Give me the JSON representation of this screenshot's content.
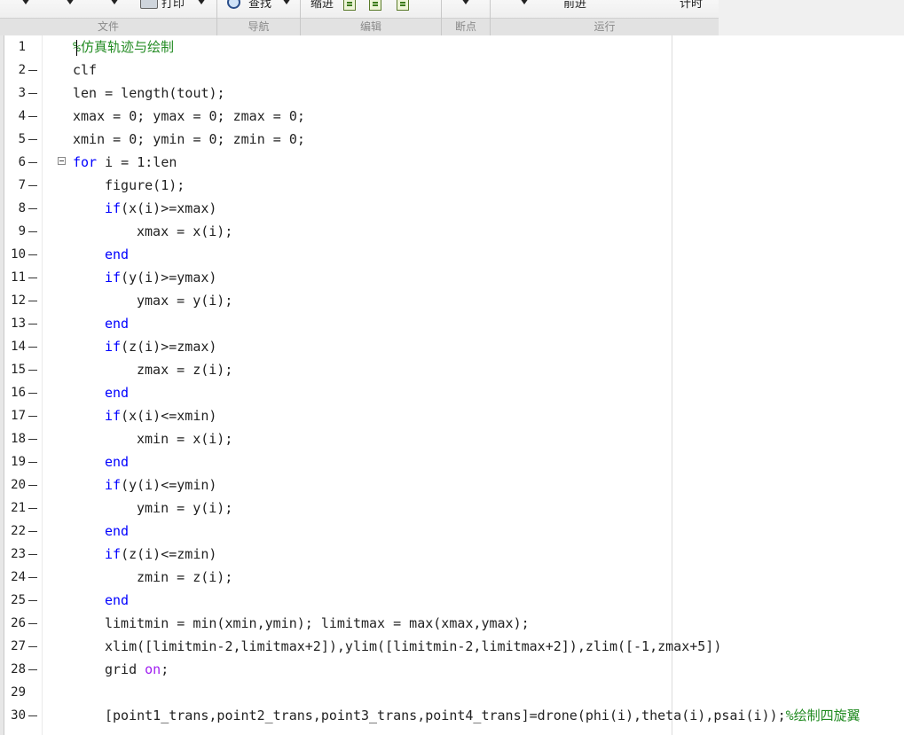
{
  "toolbar": {
    "print_label": "打印",
    "find_label": "查找",
    "indent_label": "缩进",
    "forward_label": "前进",
    "timing_label": "计时"
  },
  "ribbon_groups": [
    "文件",
    "导航",
    "编辑",
    "断点",
    "运行"
  ],
  "editor": {
    "lines": [
      {
        "n": "1",
        "dash": false,
        "fold": false,
        "indent": 0,
        "segs": [
          {
            "t": "%仿真轨迹与绘制",
            "c": "cm"
          }
        ]
      },
      {
        "n": "2",
        "dash": true,
        "fold": false,
        "indent": 0,
        "segs": [
          {
            "t": "clf",
            "c": ""
          }
        ]
      },
      {
        "n": "3",
        "dash": true,
        "fold": false,
        "indent": 0,
        "segs": [
          {
            "t": "len = length(tout);",
            "c": ""
          }
        ]
      },
      {
        "n": "4",
        "dash": true,
        "fold": false,
        "indent": 0,
        "segs": [
          {
            "t": "xmax = 0; ymax = 0; zmax = 0;",
            "c": ""
          }
        ]
      },
      {
        "n": "5",
        "dash": true,
        "fold": false,
        "indent": 0,
        "segs": [
          {
            "t": "xmin = 0; ymin = 0; zmin = 0;",
            "c": ""
          }
        ]
      },
      {
        "n": "6",
        "dash": true,
        "fold": true,
        "indent": 0,
        "segs": [
          {
            "t": "for",
            "c": "kw"
          },
          {
            "t": " i = 1:len",
            "c": ""
          }
        ]
      },
      {
        "n": "7",
        "dash": true,
        "fold": false,
        "indent": 1,
        "segs": [
          {
            "t": "figure(1);",
            "c": ""
          }
        ]
      },
      {
        "n": "8",
        "dash": true,
        "fold": false,
        "indent": 1,
        "segs": [
          {
            "t": "if",
            "c": "kw"
          },
          {
            "t": "(x(i)>=xmax)",
            "c": ""
          }
        ]
      },
      {
        "n": "9",
        "dash": true,
        "fold": false,
        "indent": 2,
        "segs": [
          {
            "t": "xmax = x(i);",
            "c": ""
          }
        ]
      },
      {
        "n": "10",
        "dash": true,
        "fold": false,
        "indent": 1,
        "segs": [
          {
            "t": "end",
            "c": "kw"
          }
        ]
      },
      {
        "n": "11",
        "dash": true,
        "fold": false,
        "indent": 1,
        "segs": [
          {
            "t": "if",
            "c": "kw"
          },
          {
            "t": "(y(i)>=ymax)",
            "c": ""
          }
        ]
      },
      {
        "n": "12",
        "dash": true,
        "fold": false,
        "indent": 2,
        "segs": [
          {
            "t": "ymax = y(i);",
            "c": ""
          }
        ]
      },
      {
        "n": "13",
        "dash": true,
        "fold": false,
        "indent": 1,
        "segs": [
          {
            "t": "end",
            "c": "kw"
          }
        ]
      },
      {
        "n": "14",
        "dash": true,
        "fold": false,
        "indent": 1,
        "segs": [
          {
            "t": "if",
            "c": "kw"
          },
          {
            "t": "(z(i)>=zmax)",
            "c": ""
          }
        ]
      },
      {
        "n": "15",
        "dash": true,
        "fold": false,
        "indent": 2,
        "segs": [
          {
            "t": "zmax = z(i);",
            "c": ""
          }
        ]
      },
      {
        "n": "16",
        "dash": true,
        "fold": false,
        "indent": 1,
        "segs": [
          {
            "t": "end",
            "c": "kw"
          }
        ]
      },
      {
        "n": "17",
        "dash": true,
        "fold": false,
        "indent": 1,
        "segs": [
          {
            "t": "if",
            "c": "kw"
          },
          {
            "t": "(x(i)<=xmin)",
            "c": ""
          }
        ]
      },
      {
        "n": "18",
        "dash": true,
        "fold": false,
        "indent": 2,
        "segs": [
          {
            "t": "xmin = x(i);",
            "c": ""
          }
        ]
      },
      {
        "n": "19",
        "dash": true,
        "fold": false,
        "indent": 1,
        "segs": [
          {
            "t": "end",
            "c": "kw"
          }
        ]
      },
      {
        "n": "20",
        "dash": true,
        "fold": false,
        "indent": 1,
        "segs": [
          {
            "t": "if",
            "c": "kw"
          },
          {
            "t": "(y(i)<=ymin)",
            "c": ""
          }
        ]
      },
      {
        "n": "21",
        "dash": true,
        "fold": false,
        "indent": 2,
        "segs": [
          {
            "t": "ymin = y(i);",
            "c": ""
          }
        ]
      },
      {
        "n": "22",
        "dash": true,
        "fold": false,
        "indent": 1,
        "segs": [
          {
            "t": "end",
            "c": "kw"
          }
        ]
      },
      {
        "n": "23",
        "dash": true,
        "fold": false,
        "indent": 1,
        "segs": [
          {
            "t": "if",
            "c": "kw"
          },
          {
            "t": "(z(i)<=zmin)",
            "c": ""
          }
        ]
      },
      {
        "n": "24",
        "dash": true,
        "fold": false,
        "indent": 2,
        "segs": [
          {
            "t": "zmin = z(i);",
            "c": ""
          }
        ]
      },
      {
        "n": "25",
        "dash": true,
        "fold": false,
        "indent": 1,
        "segs": [
          {
            "t": "end",
            "c": "kw"
          }
        ]
      },
      {
        "n": "26",
        "dash": true,
        "fold": false,
        "indent": 1,
        "segs": [
          {
            "t": "limitmin = min(xmin,ymin); limitmax = max(xmax,ymax);",
            "c": ""
          }
        ]
      },
      {
        "n": "27",
        "dash": true,
        "fold": false,
        "indent": 1,
        "segs": [
          {
            "t": "xlim([limitmin-2,limitmax+2]),ylim([limitmin-2,limitmax+2]),zlim([-1,zmax+5])",
            "c": ""
          }
        ]
      },
      {
        "n": "28",
        "dash": true,
        "fold": false,
        "indent": 1,
        "segs": [
          {
            "t": "grid ",
            "c": ""
          },
          {
            "t": "on",
            "c": "str"
          },
          {
            "t": ";",
            "c": ""
          }
        ]
      },
      {
        "n": "29",
        "dash": false,
        "fold": false,
        "indent": 1,
        "segs": []
      },
      {
        "n": "30",
        "dash": true,
        "fold": false,
        "indent": 1,
        "segs": [
          {
            "t": "[point1_trans,point2_trans,point3_trans,point4_trans]=drone(phi(i),theta(i),psai(i));",
            "c": ""
          },
          {
            "t": "%绘制四旋翼",
            "c": "cm"
          }
        ]
      }
    ]
  }
}
